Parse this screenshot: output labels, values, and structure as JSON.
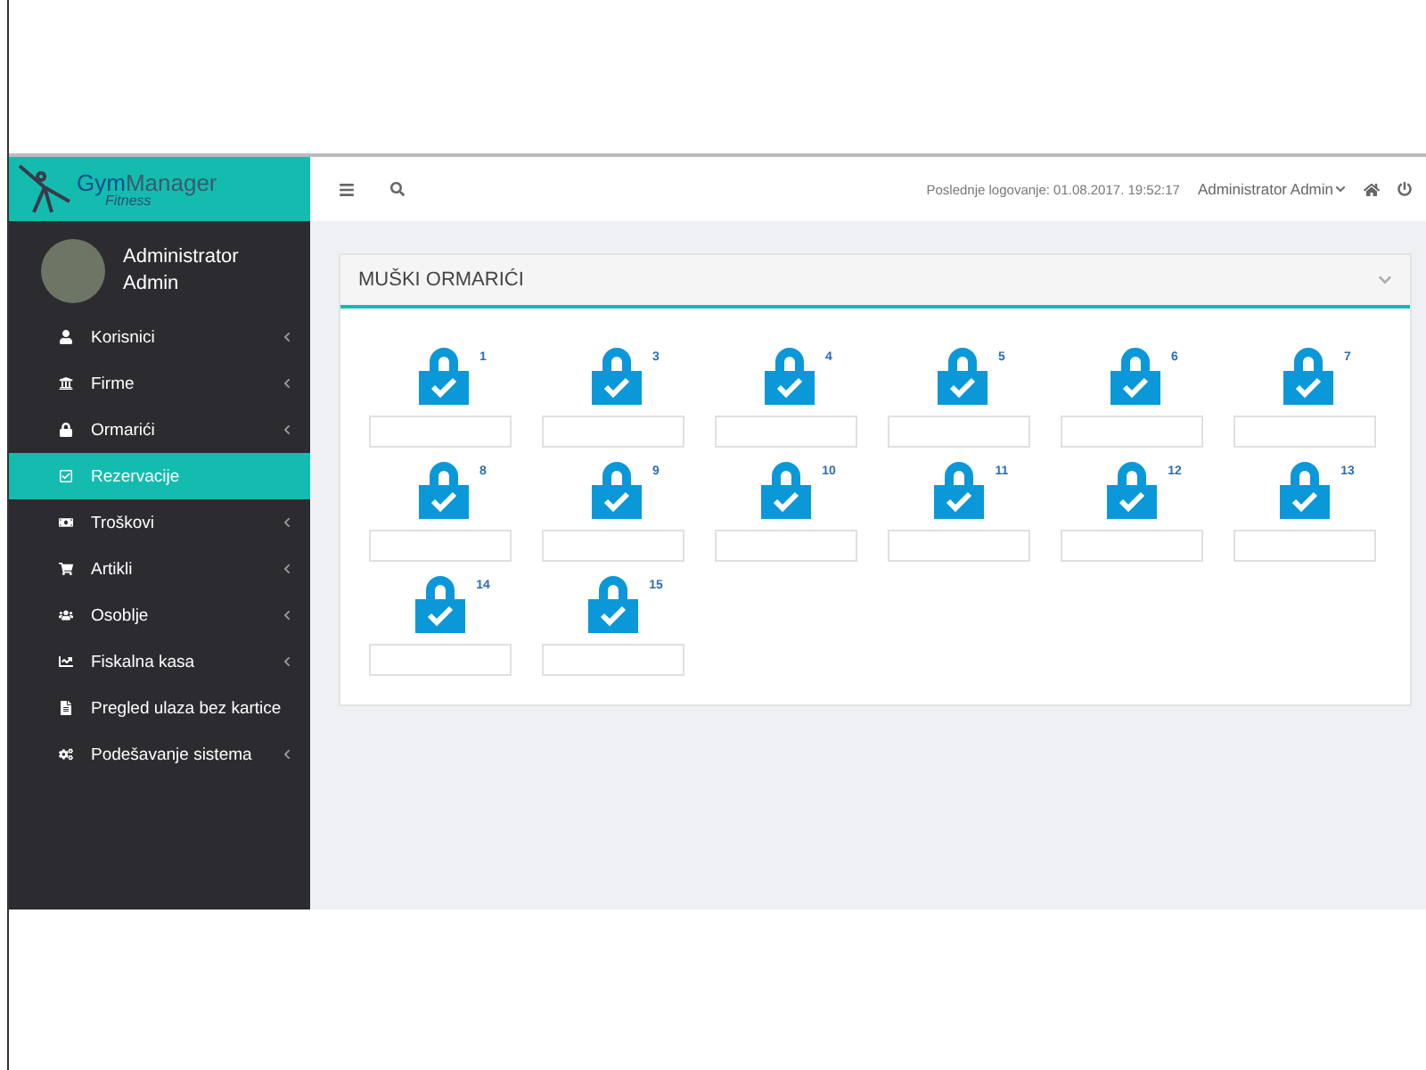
{
  "logo": {
    "part_1": "Gym",
    "part_2": "Manager",
    "subtitle": "Fitness"
  },
  "user": {
    "name": "Administrator Admin"
  },
  "nav": [
    {
      "label": "Korisnici",
      "has_submenu": true,
      "selected": false
    },
    {
      "label": "Firme",
      "has_submenu": true,
      "selected": false
    },
    {
      "label": "Ormarići",
      "has_submenu": true,
      "selected": false
    },
    {
      "label": "Rezervacije",
      "has_submenu": false,
      "selected": true
    },
    {
      "label": "Troškovi",
      "has_submenu": true,
      "selected": false
    },
    {
      "label": "Artikli",
      "has_submenu": true,
      "selected": false
    },
    {
      "label": "Osoblje",
      "has_submenu": true,
      "selected": false
    },
    {
      "label": "Fiskalna kasa",
      "has_submenu": true,
      "selected": false
    },
    {
      "label": "Pregled ulaza bez kartice",
      "has_submenu": false,
      "selected": false
    },
    {
      "label": "Podešavanje sistema",
      "has_submenu": true,
      "selected": false
    }
  ],
  "header": {
    "last_login": "Poslednje logovanje: 01.08.2017. 19:52:17",
    "user_menu": "Administrator Admin"
  },
  "panel": {
    "title": "MUŠKI ORMARIĆI",
    "lockers": [
      {
        "number": "1"
      },
      {
        "number": "3"
      },
      {
        "number": "4"
      },
      {
        "number": "5"
      },
      {
        "number": "6"
      },
      {
        "number": "7"
      },
      {
        "number": "8"
      },
      {
        "number": "9"
      },
      {
        "number": "10"
      },
      {
        "number": "11"
      },
      {
        "number": "12"
      },
      {
        "number": "13"
      },
      {
        "number": "14"
      },
      {
        "number": "15"
      }
    ]
  }
}
